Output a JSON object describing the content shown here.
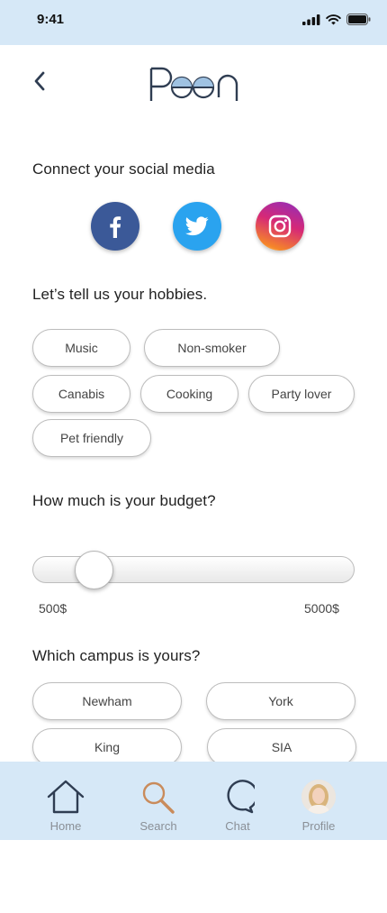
{
  "status_bar": {
    "time": "9:41"
  },
  "header": {
    "logo_text": "Poen"
  },
  "social": {
    "title": "Connect your social media",
    "items": [
      {
        "name": "Facebook",
        "icon": "facebook-icon",
        "color": "#3b5998"
      },
      {
        "name": "Twitter",
        "icon": "twitter-icon",
        "color": "#2aa3ef"
      },
      {
        "name": "Instagram",
        "icon": "instagram-icon",
        "color": "#d62976"
      }
    ]
  },
  "hobbies": {
    "title": "Let’s tell us your hobbies.",
    "items": [
      "Music",
      "Non-smoker",
      "Canabis",
      "Cooking",
      "Party lover",
      "Pet friendly"
    ]
  },
  "budget": {
    "title": "How much is your budget?",
    "min_label": "500$",
    "max_label": "5000$",
    "value_fraction": 0.15
  },
  "campus": {
    "title": "Which campus is yours?",
    "items": [
      "Newham",
      "York",
      "King",
      "SIA"
    ]
  },
  "tabbar": {
    "items": [
      {
        "label": "Home",
        "icon": "home-icon",
        "active": false
      },
      {
        "label": "Search",
        "icon": "search-icon",
        "active": true
      },
      {
        "label": "Chat",
        "icon": "chat-icon",
        "active": false
      },
      {
        "label": "Profile",
        "icon": "avatar",
        "active": false
      }
    ]
  },
  "colors": {
    "bar_background": "#d6e8f7",
    "search_accent": "#c98b5b",
    "logo_navy": "#2f3d52"
  }
}
